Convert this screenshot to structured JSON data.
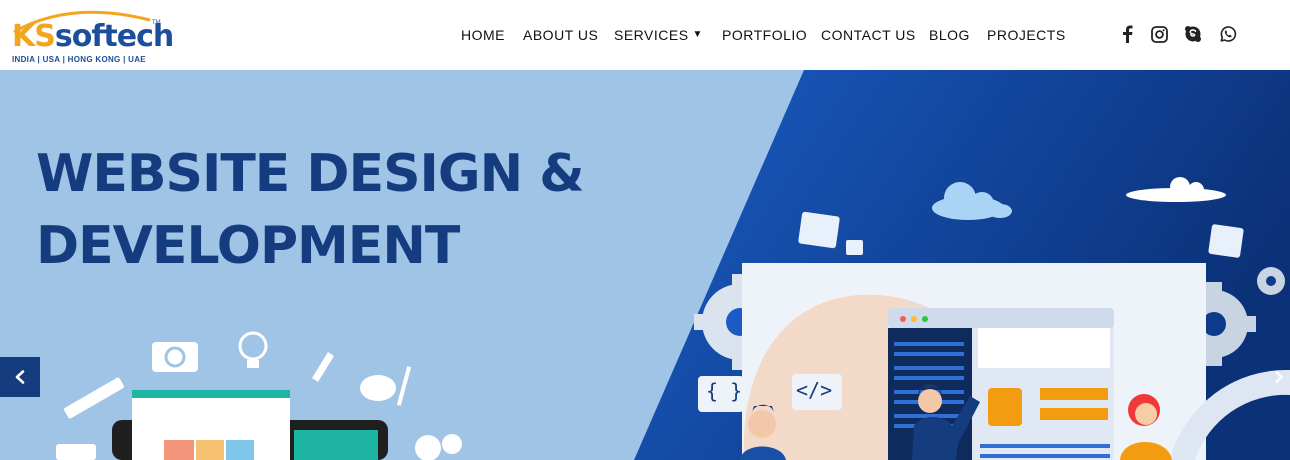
{
  "brand": {
    "logo_prefix": "KS",
    "logo_suffix": "softech",
    "tagline": "INDIA | USA | HONG KONG | UAE",
    "colors": {
      "primary": "#1c4e9c",
      "accent": "#f4a51c"
    }
  },
  "nav": {
    "items": [
      {
        "label": "HOME"
      },
      {
        "label": "ABOUT US"
      },
      {
        "label": "SERVICES",
        "has_dropdown": true
      },
      {
        "label": "PORTFOLIO"
      },
      {
        "label": "CONTACT US"
      },
      {
        "label": "BLOG"
      },
      {
        "label": "PROJECTS"
      }
    ]
  },
  "social": [
    "facebook-icon",
    "instagram-icon",
    "skype-icon",
    "whatsapp-icon"
  ],
  "hero": {
    "title_line1": "WEBSITE DESIGN &",
    "title_line2": "DEVELOPMENT",
    "code_brackets": "{ }",
    "code_tag": "</>",
    "colors": {
      "light_bg": "#a0c4e6",
      "dark_bg": "#0d3b8c",
      "title": "#163c80"
    }
  },
  "slider": {
    "prev_icon": "chevron-left-icon",
    "next_icon": "chevron-right-icon"
  }
}
